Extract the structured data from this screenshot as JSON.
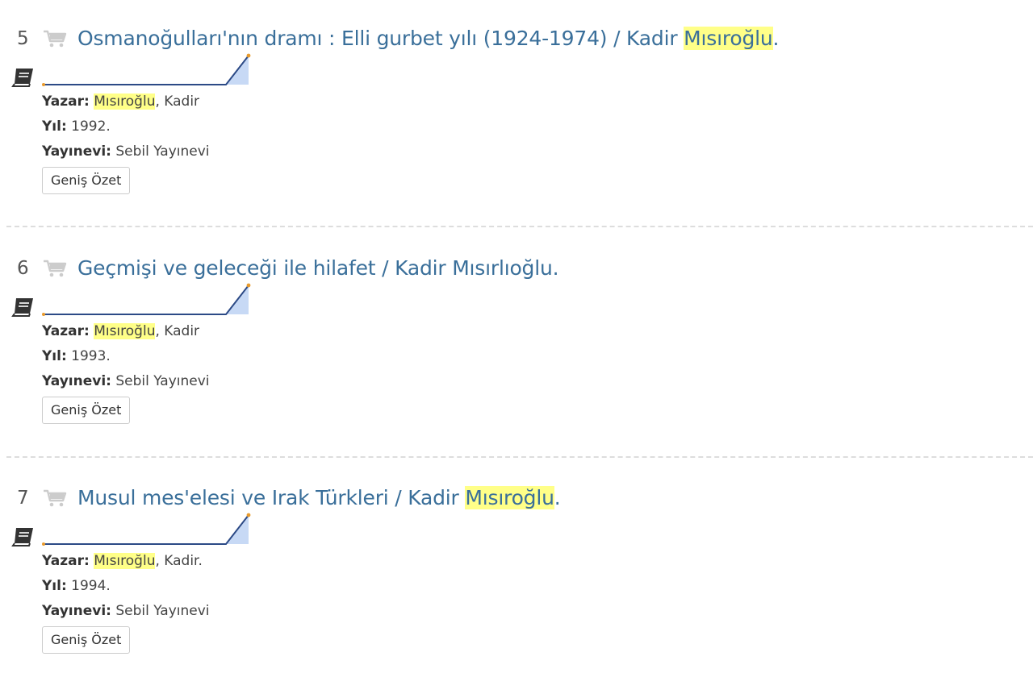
{
  "results": [
    {
      "number": "5",
      "title_pre": "Osmanoğulları'nın dramı : Elli gurbet yılı (1924-1974) / Kadir ",
      "title_highlight": "Mısıroğlu",
      "title_post": ".",
      "author_label": "Yazar:",
      "author_highlight": "Mısıroğlu",
      "author_rest": ", Kadir",
      "year_label": "Yıl:",
      "year_value": " 1992.",
      "publisher_label": "Yayınevi:",
      "publisher_value": " Sebil Yayınevi",
      "button_label": "Geniş Özet"
    },
    {
      "number": "6",
      "title_pre": "Geçmişi ve geleceği ile hilafet / Kadir Mısırlıoğlu.",
      "title_highlight": "",
      "title_post": "",
      "author_label": "Yazar:",
      "author_highlight": "Mısıroğlu",
      "author_rest": ", Kadir",
      "year_label": "Yıl:",
      "year_value": " 1993.",
      "publisher_label": "Yayınevi:",
      "publisher_value": " Sebil Yayınevi",
      "button_label": "Geniş Özet"
    },
    {
      "number": "7",
      "title_pre": "Musul mes'elesi ve Irak Türkleri / Kadir ",
      "title_highlight": "Mısıroğlu",
      "title_post": ".",
      "author_label": "Yazar:",
      "author_highlight": "Mısıroğlu",
      "author_rest": ", Kadir.",
      "year_label": "Yıl:",
      "year_value": " 1994.",
      "publisher_label": "Yayınevi:",
      "publisher_value": " Sebil Yayınevi",
      "button_label": "Geniş Özet"
    }
  ],
  "icons": {
    "cart": "shopping-cart-icon",
    "book": "book-icon"
  },
  "colors": {
    "title_link": "#3a6f9a",
    "highlight": "#ffff88",
    "icon_gray": "#cccccc",
    "shelf_line": "#2c4a86",
    "shelf_fill": "#c7d9f5",
    "shelf_dot": "#e89a2c"
  }
}
